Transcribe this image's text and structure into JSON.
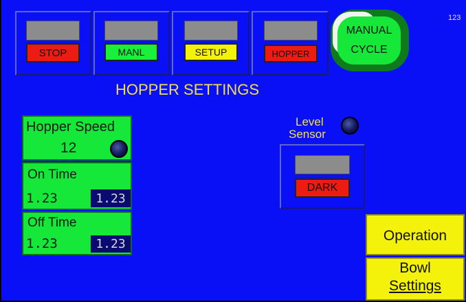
{
  "top_bar": {
    "stop_label": "STOP",
    "manl_label": "MANL",
    "setup_label": "SETUP",
    "hopper_label": "HOPPER",
    "manual_cycle_line1": "MANUAL",
    "manual_cycle_line2": "CYCLE",
    "corner_number": "123"
  },
  "page_title": "HOPPER SETTINGS",
  "hopper_speed": {
    "label": "Hopper Speed",
    "value": "12"
  },
  "on_time": {
    "label": "On Time",
    "value": "1.23",
    "entry": "1.23"
  },
  "off_time": {
    "label": "Off Time",
    "value": "1.23",
    "entry": "1.23"
  },
  "level_sensor": {
    "label_line1": "Level",
    "label_line2": "Sensor",
    "state": "DARK"
  },
  "nav": {
    "operation": "Operation",
    "bowl_line1": "Bowl",
    "bowl_line2": "Settings"
  },
  "colors": {
    "background": "#0a10f5",
    "green": "#18f03a",
    "red": "#ec1c12",
    "yellow": "#f4f20a",
    "title": "#f2e04a"
  }
}
